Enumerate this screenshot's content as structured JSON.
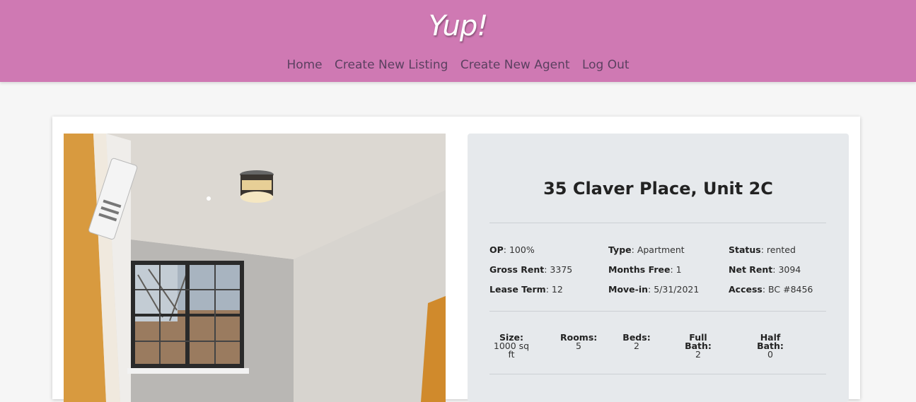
{
  "header": {
    "brand": "Yup!",
    "nav": [
      "Home",
      "Create New Listing",
      "Create New Agent",
      "Log Out"
    ]
  },
  "listing": {
    "address": "35 Claver Place, Unit 2C",
    "details": {
      "op_label": "OP",
      "op_value": "100%",
      "type_label": "Type",
      "type_value": "Apartment",
      "status_label": "Status",
      "status_value": "rented",
      "gross_rent_label": "Gross Rent",
      "gross_rent_value": "3375",
      "months_free_label": "Months Free",
      "months_free_value": "1",
      "net_rent_label": "Net Rent",
      "net_rent_value": "3094",
      "lease_term_label": "Lease Term",
      "lease_term_value": "12",
      "move_in_label": "Move-in",
      "move_in_value": "5/31/2021",
      "access_label": "Access",
      "access_value": "BC #8456"
    },
    "specs": {
      "size_label": "Size:",
      "size_value": "1000 sq ft",
      "rooms_label": "Rooms:",
      "rooms_value": "5",
      "beds_label": "Beds:",
      "beds_value": "2",
      "full_bath_label": "Full Bath:",
      "full_bath_value": "2",
      "half_bath_label": "Half Bath:",
      "half_bath_value": "0"
    }
  },
  "colors": {
    "header_bg": "#cf79b3",
    "nav_text": "#5b4060",
    "info_bg": "#e6e9ec"
  }
}
